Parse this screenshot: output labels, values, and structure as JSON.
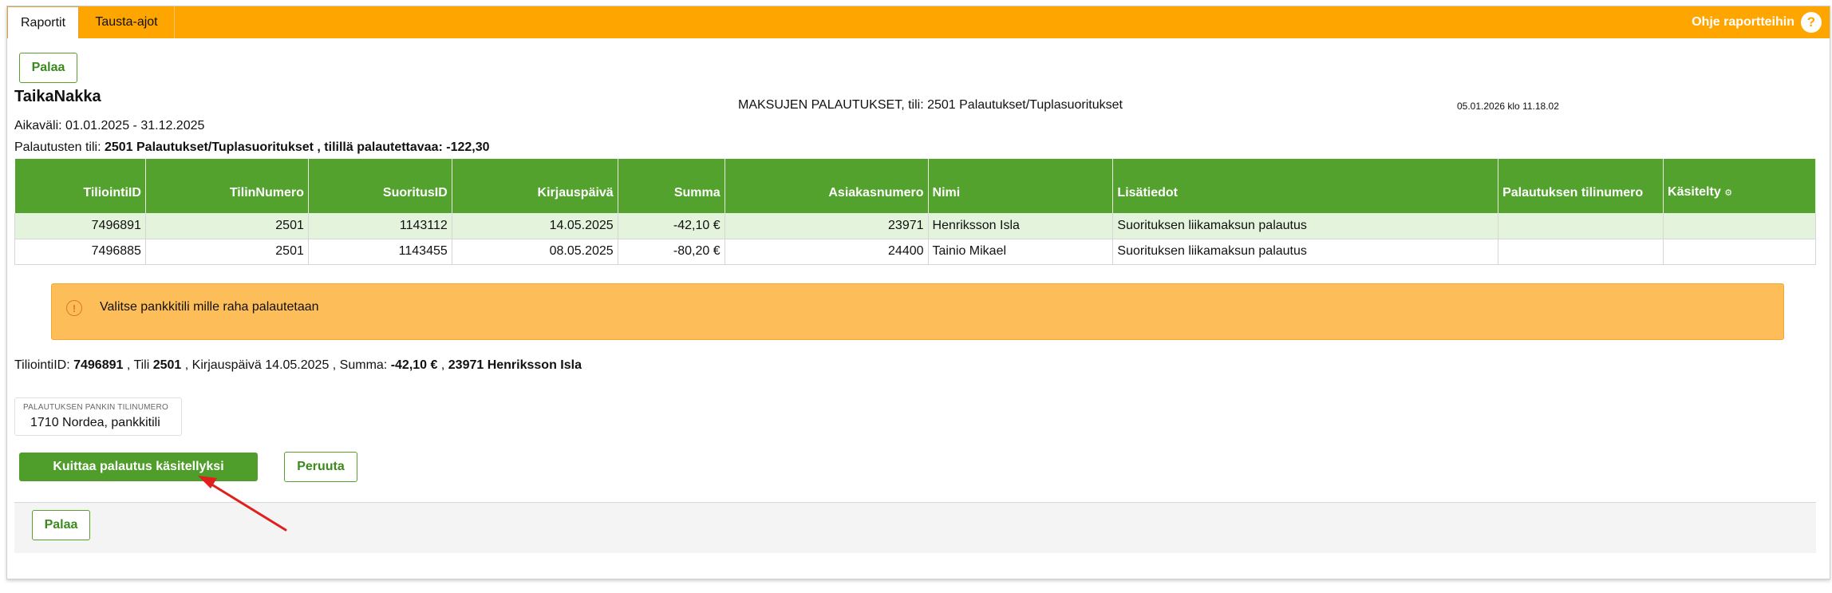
{
  "tabs": [
    {
      "label": "Raportit"
    },
    {
      "label": "Tausta-ajot"
    }
  ],
  "help": {
    "label": "Ohje raportteihin",
    "icon": "question-icon"
  },
  "buttons": {
    "back_top": "Palaa",
    "confirm": "Kuittaa palautus käsitellyksi",
    "cancel": "Peruuta",
    "back_bottom": "Palaa"
  },
  "header": {
    "company": "TaikaNakka",
    "report_title": "MAKSUJEN PALAUTUKSET, tili: 2501 Palautukset/Tuplasuoritukset",
    "timestamp": "05.01.2026 klo 11.18.02",
    "range": "Aikaväli: 01.01.2025 - 31.12.2025",
    "account_prefix": "Palautusten tili: ",
    "account_value": "2501 Palautukset/Tuplasuoritukset , tilillä palautettavaa: -122,30"
  },
  "table": {
    "columns": [
      "TiliointiID",
      "TilinNumero",
      "SuoritusID",
      "Kirjauspäivä",
      "Summa",
      "Asiakasnumero",
      "Nimi",
      "Lisätiedot",
      "Palautuksen tilinumero",
      "Käsitelty"
    ],
    "sort_icon": "⚙",
    "rows": [
      [
        "7496891",
        "2501",
        "1143112",
        "14.05.2025",
        "-42,10 €",
        "23971",
        "Henriksson Isla",
        "Suorituksen liikamaksun palautus",
        "",
        ""
      ],
      [
        "7496885",
        "2501",
        "1143455",
        "08.05.2025",
        "-80,20 €",
        "24400",
        "Tainio Mikael",
        "Suorituksen liikamaksun palautus",
        "",
        ""
      ]
    ]
  },
  "alert": {
    "icon": "info-icon",
    "message": "Valitse pankkitili mille raha palautetaan"
  },
  "summary": {
    "l1": "TiliointiID: ",
    "v1": "7496891",
    "l2": " , Tili ",
    "v2": "2501",
    "l3": " , Kirjauspäivä 14.05.2025 , Summa: ",
    "v3": "-42,10 €",
    "l4": " , ",
    "v4": "23971 Henriksson Isla"
  },
  "bank_field": {
    "label": "PALAUTUKSEN PANKIN TILINUMERO",
    "value": "1710 Nordea, pankkitili"
  },
  "colors": {
    "accent_orange": "#ffa500",
    "accent_green": "#53a22d",
    "alert_bg": "#fdbd58",
    "arrow": "#e0201c"
  }
}
